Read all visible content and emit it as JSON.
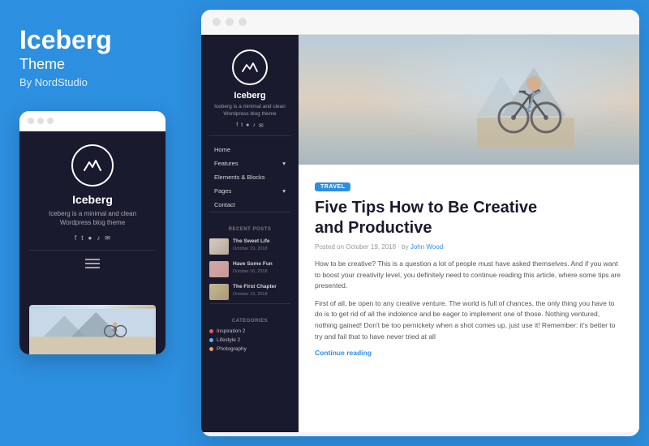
{
  "left": {
    "brand_title": "Iceberg",
    "brand_subtitle": "Theme",
    "brand_author": "By NordStudio",
    "mobile_preview": {
      "site_name": "Iceberg",
      "site_desc": "Iceberg is a minimal and clean\nWordpress blog theme"
    }
  },
  "browser": {
    "dots": [
      "dot1",
      "dot2",
      "dot3"
    ]
  },
  "sidebar": {
    "site_name": "Iceberg",
    "site_desc": "Iceberg is a minimal and clean Wordpress blog theme",
    "social_icons": [
      "f",
      "t",
      "i",
      "d",
      "w"
    ],
    "nav": [
      {
        "label": "Home",
        "has_arrow": false
      },
      {
        "label": "Features",
        "has_arrow": true
      },
      {
        "label": "Elements & Blocks",
        "has_arrow": false
      },
      {
        "label": "Pages",
        "has_arrow": true
      },
      {
        "label": "Contact",
        "has_arrow": false
      }
    ],
    "recent_posts_title": "RECENT POSTS",
    "recent_posts": [
      {
        "title": "The Sweet Life",
        "date": "October 19, 2018"
      },
      {
        "title": "Have Some Fun",
        "date": "October 16, 2018"
      },
      {
        "title": "The First Chapter",
        "date": "October 13, 2018"
      }
    ],
    "categories_title": "CATEGORIES",
    "categories": [
      {
        "label": "Inspiration 2",
        "color": "#e85c5c"
      },
      {
        "label": "Lifestyle 2",
        "color": "#5cb8e8"
      },
      {
        "label": "Photography",
        "color": "#e8a05c"
      }
    ]
  },
  "article": {
    "tag": "TRAVEL",
    "title_line1": "Five Tips How to Be Creative",
    "title_line2": "and Productive",
    "meta": "Posted on October 19, 2018 · by John Wood",
    "paragraph1": "How to be creative? This is a question a lot of people must have asked themselves. And if you want to boost your creativity level, you definitely need to continue reading this article, where some tips are presented.",
    "paragraph2": "First of all, be open to any creative venture. The world is full of chances, the only thing you have to do is to get rid of all the indolence and be eager to implement one of those. Nothing ventured, nothing gained! Don't be too pernickety when a shot comes up, just use it! Remember: it's better to try and fail that to have never tried at all",
    "continue_reading": "Continue reading"
  }
}
